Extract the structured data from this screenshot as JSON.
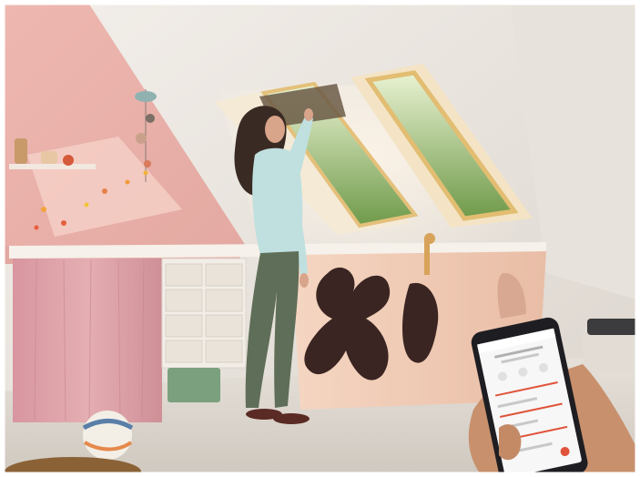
{
  "scene": {
    "description_colors": {
      "wall_pink": "#e9b7b1",
      "ceiling": "#ece7e2",
      "floor": "#ddd7cf",
      "counter_top": "#f4efe9",
      "curtain": "#d89ea0",
      "drawers": "#f3efe8",
      "radiator_cover": "#f0cbb6",
      "window_frame": "#e6c37a",
      "sky_green": "#8fb86a",
      "shirt": "#bfe0df",
      "pants": "#5f6e58",
      "hair": "#3a2a24",
      "phone_body": "#1e1e22",
      "phone_screen": "#f7f7f7",
      "accent_red": "#e0533a",
      "hand": "#c8906c"
    },
    "icons": [
      "ceiling-mobile-icon",
      "ball-icon",
      "phone-icon",
      "window-icon"
    ]
  }
}
